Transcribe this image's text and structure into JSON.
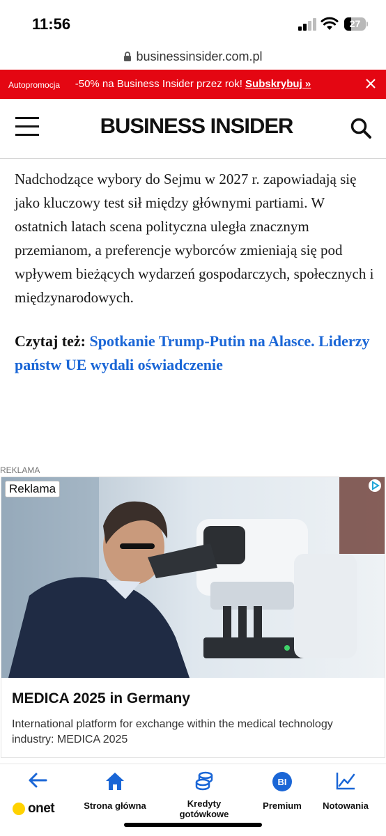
{
  "status_bar": {
    "time": "11:56",
    "battery_level": "27",
    "icons": [
      "signal-icon",
      "wifi-icon",
      "battery-icon"
    ]
  },
  "browser": {
    "url": "businessinsider.com.pl",
    "lock_icon": "lock-icon"
  },
  "promo": {
    "label": "Autopromocja",
    "text": "-50% na Business Insider przez rok!",
    "link": "Subskrybuj »",
    "background": "#e40612"
  },
  "header": {
    "logo": "BUSINESS INSIDER",
    "menu_icon": "hamburger-icon",
    "search_icon": "search-icon"
  },
  "article": {
    "paragraph": "Nadchodzące wybory do Sejmu w 2027 r. zapowiadają się jako kluczowy test sił między głównymi partiami. W ostatnich latach scena polityczna uległa znacznym przemianom, a preferencje wyborców zmieniają się pod wpływem bieżących wydarzeń gospodarczych, społecznych i międzynarodowych.",
    "read_also_label": "Czytaj też:",
    "read_also_link": "Spotkanie Trump-Putin na Alasce. Liderzy państw UE wydali oświadczenie",
    "link_color": "#1a66d6"
  },
  "ad": {
    "section_label": "REKLAMA",
    "badge": "Reklama",
    "title": "MEDICA 2025 in Germany",
    "description": "International platform for exchange within the medical technology industry: MEDICA 2025"
  },
  "bottom_nav": {
    "items": [
      {
        "label": "onet",
        "icon": "back-arrow-icon"
      },
      {
        "label": "Strona główna",
        "icon": "home-icon"
      },
      {
        "label": "Kredyty gotówkowe",
        "icon": "coins-icon"
      },
      {
        "label": "Premium",
        "icon": "bi-icon"
      },
      {
        "label": "Notowania",
        "icon": "chart-icon"
      }
    ],
    "accent": "#1a66d6"
  }
}
